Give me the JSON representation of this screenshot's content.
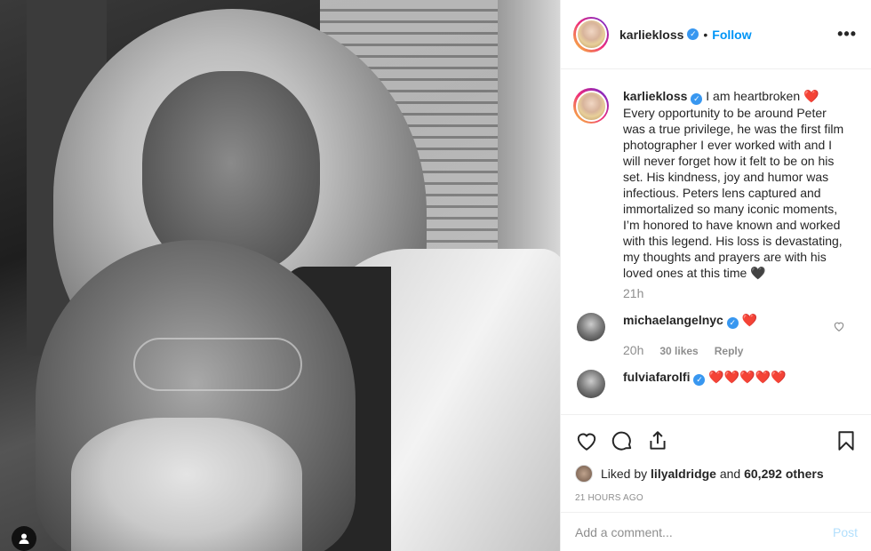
{
  "post": {
    "username": "karliekloss",
    "dot": "•",
    "follow_label": "Follow",
    "more_label": "•••"
  },
  "caption": {
    "username": "karliekloss",
    "text": "I am heartbroken ❤️ Every opportunity to be around Peter was a true privilege, he was the first film photographer I ever worked with and I will never forget how it felt to be on his set. His kindness, joy and humor was infectious. Peters lens captured and immortalized so many iconic moments, I’m honored to have known and worked with this legend. His loss is devastating, my thoughts and prayers are with his loved ones at this time 🖤",
    "time": "21h"
  },
  "comments": [
    {
      "username": "michaelangelnyc",
      "text": "❤️",
      "time": "20h",
      "likes": "30 likes",
      "reply": "Reply"
    },
    {
      "username": "fulviafarolfi",
      "text": "❤️❤️❤️❤️❤️"
    }
  ],
  "likes": {
    "prefix": "Liked by",
    "user": "lilyaldridge",
    "and": "and",
    "count": "60,292 others"
  },
  "posted_ago": "21 HOURS AGO",
  "add_comment": {
    "placeholder": "Add a comment...",
    "post_label": "Post"
  },
  "colors": {
    "accent": "#0095f6",
    "verified": "#3897f0",
    "muted": "#8e8e8e",
    "heart": "#ed4956"
  }
}
